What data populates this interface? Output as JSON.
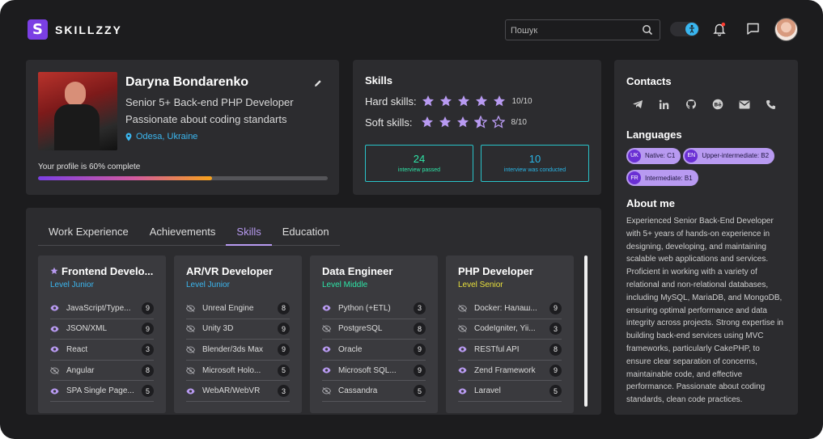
{
  "header": {
    "logo_mark": "S",
    "logo_text": "SKILLZZY",
    "search_placeholder": "Пошук"
  },
  "icons": [
    "search-icon",
    "accessibility-icon",
    "bell-icon",
    "chat-icon",
    "pencil-icon",
    "location-pin-icon",
    "telegram-icon",
    "linkedin-icon",
    "github-icon",
    "behance-icon",
    "mail-icon",
    "phone-icon",
    "eye-icon",
    "eye-off-icon",
    "star-icon"
  ],
  "colors": {
    "accent": "#7b3fe4",
    "accent_light": "#b89af1",
    "cyan": "#29c3c9",
    "blue": "#3bb7f0",
    "junior": "#3bb7f0",
    "middle": "#2ee6a8",
    "senior": "#e8e03c",
    "background": "#1c1c1e",
    "card": "#2c2c2f"
  },
  "profile": {
    "name": "Daryna Bondarenko",
    "role": "Senior 5+ Back-end PHP Developer",
    "tagline": "Passionate about coding standarts",
    "location": "Odesa, Ukraine",
    "completion_label": "Your profile is 60% complete",
    "completion_percent": 60
  },
  "skills_summary": {
    "title": "Skills",
    "hard_label": "Hard skills:",
    "hard_rating": 5,
    "hard_value": "10/10",
    "soft_label": "Soft skills:",
    "soft_rating": 3.5,
    "soft_value": "8/10",
    "stats": [
      {
        "number": "24",
        "label": "interview passed"
      },
      {
        "number": "10",
        "label": "interview was conducted"
      }
    ]
  },
  "contacts": {
    "title": "Contacts",
    "languages_title": "Languages",
    "languages": [
      {
        "code": "UK",
        "label": "Native: C1"
      },
      {
        "code": "EN",
        "label": "Upper-intermediate: B2"
      },
      {
        "code": "FR",
        "label": "Intermediate: B1"
      }
    ],
    "about_title": "About me",
    "about_text": "Experienced Senior Back-End Developer with 5+ years of hands-on experience in designing, developing, and maintaining scalable web applications and services. Proficient in working with a variety of relational and non-relational databases, including MySQL, MariaDB, and MongoDB, ensuring optimal performance and data integrity across projects. Strong expertise in building back-end services using MVC frameworks, particularly CakePHP, to ensure clear separation of concerns, maintainable code, and effective performance. Passionate about coding standards, clean code practices."
  },
  "tabs": [
    "Work Experience",
    "Achievements",
    "Skills",
    "Education"
  ],
  "active_tab": "Skills",
  "skill_cards": [
    {
      "title": "Frontend Develo...",
      "starred": true,
      "level": "Level Junior",
      "level_color": "#3bb7f0",
      "items": [
        {
          "name": "JavaScript/Type...",
          "count": "9",
          "visible": true
        },
        {
          "name": "JSON/XML",
          "count": "9",
          "visible": true
        },
        {
          "name": "React",
          "count": "3",
          "visible": true
        },
        {
          "name": "Angular",
          "count": "8",
          "visible": false
        },
        {
          "name": "SPA Single Page...",
          "count": "5",
          "visible": true
        }
      ]
    },
    {
      "title": "AR/VR Developer",
      "starred": false,
      "level": "Level Junior",
      "level_color": "#3bb7f0",
      "items": [
        {
          "name": "Unreal Engine",
          "count": "8",
          "visible": false
        },
        {
          "name": "Unity 3D",
          "count": "9",
          "visible": false
        },
        {
          "name": "Blender/3ds Max",
          "count": "9",
          "visible": false
        },
        {
          "name": "Microsoft Holo...",
          "count": "5",
          "visible": false
        },
        {
          "name": "WebAR/WebVR",
          "count": "3",
          "visible": true
        }
      ]
    },
    {
      "title": "Data Engineer",
      "starred": false,
      "level": "Level Middle",
      "level_color": "#2ee6a8",
      "items": [
        {
          "name": "Python (+ETL)",
          "count": "3",
          "visible": true
        },
        {
          "name": "PostgreSQL",
          "count": "8",
          "visible": false
        },
        {
          "name": "Oracle",
          "count": "9",
          "visible": true
        },
        {
          "name": "Microsoft SQL...",
          "count": "9",
          "visible": true
        },
        {
          "name": "Cassandra",
          "count": "5",
          "visible": false
        }
      ]
    },
    {
      "title": "PHP Developer",
      "starred": false,
      "level": "Level Senior",
      "level_color": "#e8e03c",
      "items": [
        {
          "name": "Docker: Налаш...",
          "count": "9",
          "visible": false
        },
        {
          "name": "CodeIgniter, Yii...",
          "count": "3",
          "visible": false
        },
        {
          "name": "RESTful API",
          "count": "8",
          "visible": true
        },
        {
          "name": "Zend Framework",
          "count": "9",
          "visible": true
        },
        {
          "name": "Laravel",
          "count": "5",
          "visible": true
        }
      ]
    }
  ]
}
